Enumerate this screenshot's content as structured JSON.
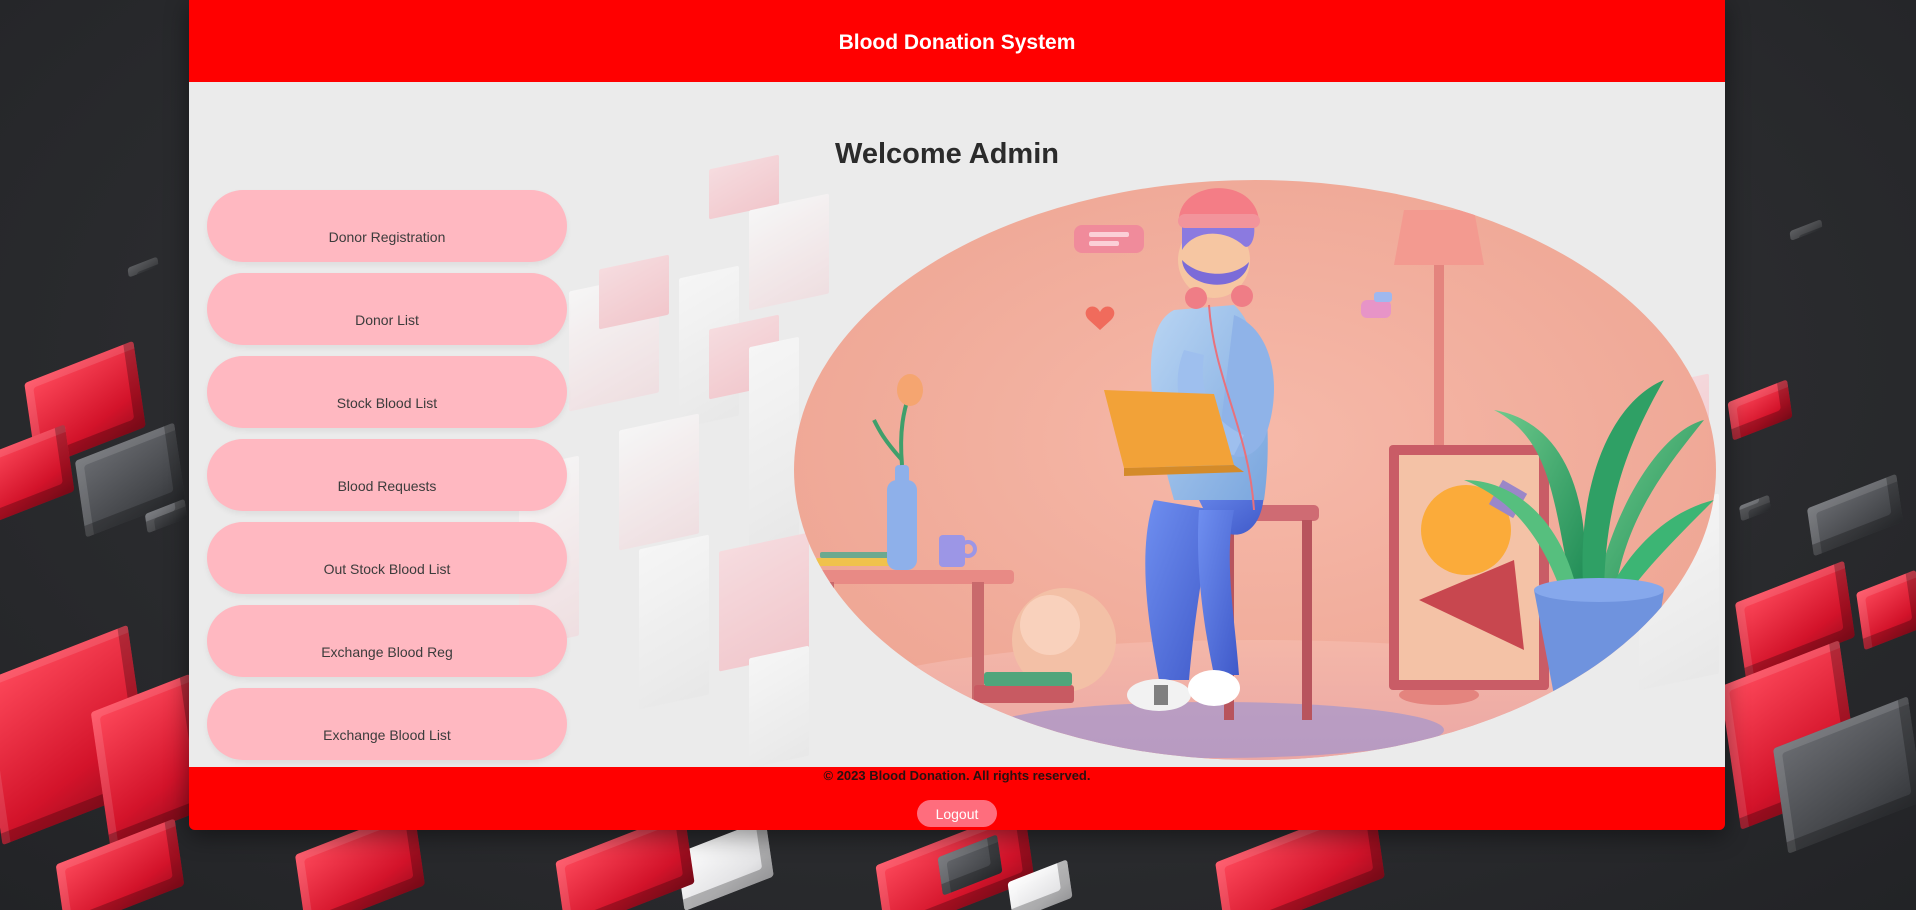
{
  "header": {
    "title": "Blood Donation System"
  },
  "main": {
    "welcome": "Welcome Admin",
    "menu": [
      {
        "label": "Donor Registration"
      },
      {
        "label": "Donor List"
      },
      {
        "label": "Stock Blood List"
      },
      {
        "label": "Blood Requests"
      },
      {
        "label": "Out Stock Blood List"
      },
      {
        "label": "Exchange Blood Reg"
      },
      {
        "label": "Exchange Blood List"
      }
    ]
  },
  "footer": {
    "copyright": "© 2023 Blood Donation. All rights reserved.",
    "logout_label": "Logout"
  },
  "colors": {
    "header_bg": "#ff0000",
    "menu_button_bg": "#ffb8c1",
    "logout_bg": "#ff6d7d",
    "content_bg": "#ebebeb"
  }
}
